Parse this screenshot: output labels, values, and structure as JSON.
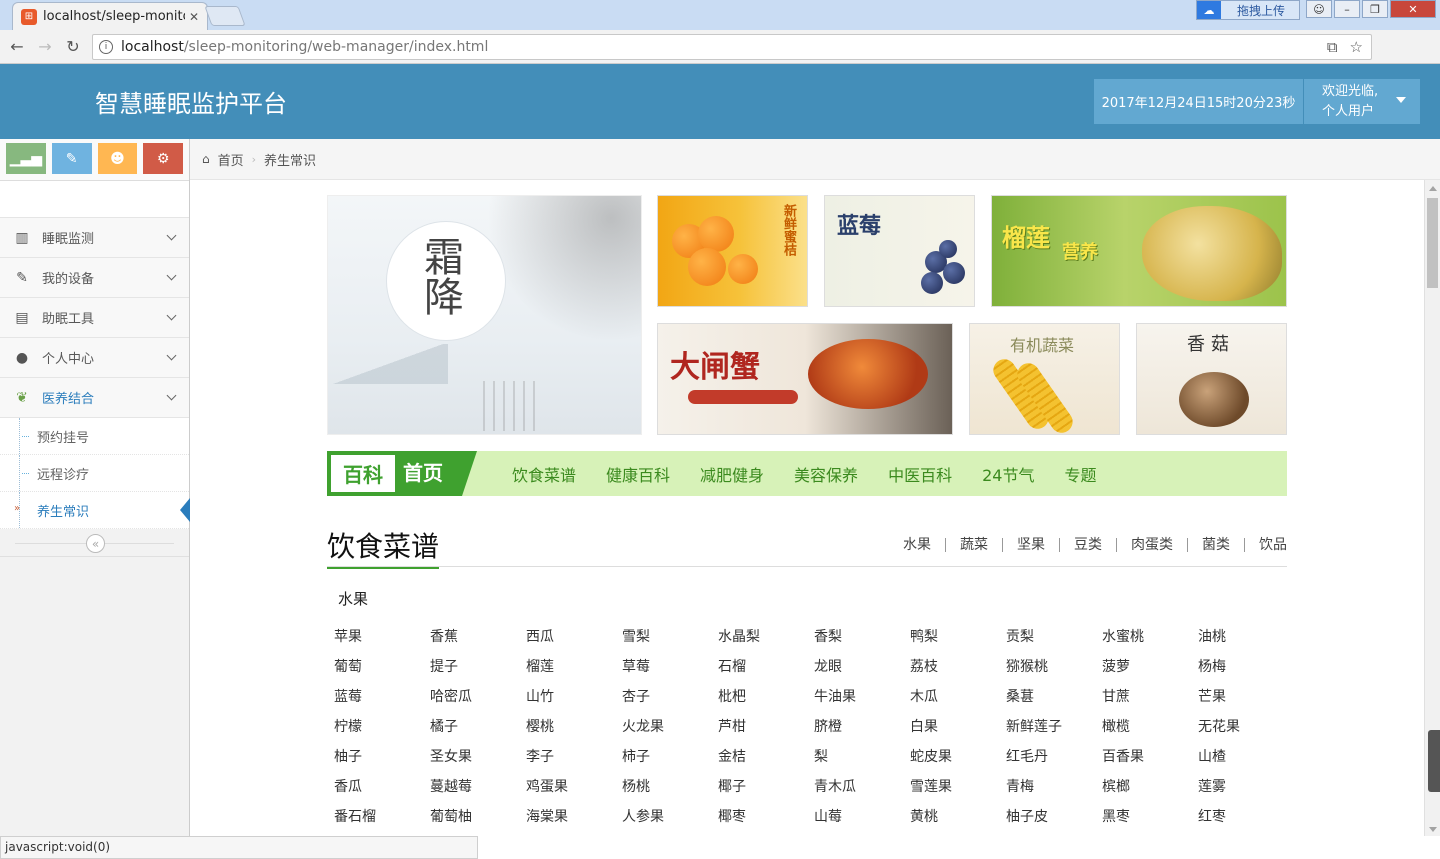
{
  "browser": {
    "tab_title": "localhost/sleep-monito",
    "url_host": "localhost",
    "url_path": "/sleep-monitoring/web-manager/index.html",
    "upload_label": "拖拽上传"
  },
  "header": {
    "app_title": "智慧睡眠监护平台",
    "datetime": "2017年12月24日15时20分23秒",
    "welcome": "欢迎光临,",
    "user": "个人用户"
  },
  "sidebar": {
    "menu": [
      {
        "label": "睡眠监测",
        "icon": "bar-chart-icon"
      },
      {
        "label": "我的设备",
        "icon": "pencil-icon"
      },
      {
        "label": "助眠工具",
        "icon": "briefcase-icon"
      },
      {
        "label": "个人中心",
        "icon": "user-icon"
      },
      {
        "label": "医养结合",
        "icon": "leaf-icon"
      }
    ],
    "submenu": [
      "预约挂号",
      "远程诊疗",
      "养生常识"
    ]
  },
  "breadcrumb": {
    "home": "首页",
    "current": "养生常识"
  },
  "banners": {
    "frost": "霜降",
    "orange": "新鲜蜜桔",
    "blueberry": "蓝莓",
    "durian": "榴莲",
    "durian_sub": "营养",
    "crab": "大闸蟹",
    "corn": "有机蔬菜",
    "mushroom": "香菇"
  },
  "catnav": {
    "logo_a": "百科",
    "logo_b": "首页",
    "links": [
      "饮食菜谱",
      "健康百科",
      "减肥健身",
      "美容保养",
      "中医百科",
      "24节气",
      "专题"
    ]
  },
  "section": {
    "title": "饮食菜谱",
    "tabs": [
      "水果",
      "蔬菜",
      "坚果",
      "豆类",
      "肉蛋类",
      "菌类",
      "饮品"
    ],
    "subhead": "水果",
    "items": [
      "苹果",
      "香蕉",
      "西瓜",
      "雪梨",
      "水晶梨",
      "香梨",
      "鸭梨",
      "贡梨",
      "水蜜桃",
      "油桃",
      "葡萄",
      "提子",
      "榴莲",
      "草莓",
      "石榴",
      "龙眼",
      "荔枝",
      "猕猴桃",
      "菠萝",
      "杨梅",
      "蓝莓",
      "哈密瓜",
      "山竹",
      "杏子",
      "枇杷",
      "牛油果",
      "木瓜",
      "桑葚",
      "甘蔗",
      "芒果",
      "柠檬",
      "橘子",
      "樱桃",
      "火龙果",
      "芦柑",
      "脐橙",
      "白果",
      "新鲜莲子",
      "橄榄",
      "无花果",
      "柚子",
      "圣女果",
      "李子",
      "柿子",
      "金桔",
      "梨",
      "蛇皮果",
      "红毛丹",
      "百香果",
      "山楂",
      "香瓜",
      "蔓越莓",
      "鸡蛋果",
      "杨桃",
      "椰子",
      "青木瓜",
      "雪莲果",
      "青梅",
      "槟榔",
      "莲雾",
      "番石榴",
      "葡萄柚",
      "海棠果",
      "人参果",
      "椰枣",
      "山莓",
      "黄桃",
      "柚子皮",
      "黑枣",
      "红枣"
    ]
  },
  "status": "javascript:void(0)",
  "colors": {
    "header_bg": "#438eb9",
    "accent_green": "#3fa12f",
    "nav_bg": "#d7f2b8"
  }
}
